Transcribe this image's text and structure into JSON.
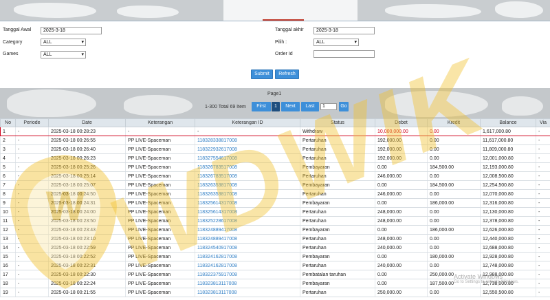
{
  "form": {
    "tanggal_awal_label": "Tanggal Awal",
    "tanggal_awal_value": "2025-3-18",
    "tanggal_akhir_label": "Tanggal akhir",
    "tanggal_akhir_value": "2025-3-18",
    "category_label": "Category",
    "category_value": "ALL",
    "pilih_label": "Pilih :",
    "pilih_value": "ALL",
    "games_label": "Games",
    "games_value": "ALL",
    "order_id_label": "Order Id",
    "order_id_value": "",
    "submit_label": "Submit",
    "refresh_label": "Refresh"
  },
  "pager": {
    "title": "Page1",
    "total": "1-300 Total 69 Item",
    "first": "First",
    "current": "1",
    "next": "Next",
    "last": "Last",
    "page_input": "1",
    "go": "Go"
  },
  "table": {
    "headers": [
      "No",
      "Periode",
      "Date",
      "Keterangan",
      "Keterangan ID",
      "Status",
      "Debet",
      "Kredit",
      "Balance",
      "Via"
    ],
    "rows": [
      [
        "1",
        "-",
        "2025-03-18 00:28:23",
        "-",
        "-",
        "Withdraw",
        "10,000,000.00",
        "0.00",
        "1,617,000.80",
        "-"
      ],
      [
        "2",
        "-",
        "2025-03-18 00:26:55",
        "PP LIVE-Spaceman",
        "118328338817008",
        "Pertaruhan",
        "192,000.00",
        "0.00",
        "11,617,000.80",
        "-"
      ],
      [
        "3",
        "-",
        "2025-03-18 00:26:40",
        "PP LIVE-Spaceman",
        "118322932617008",
        "Pertaruhan",
        "192,000.00",
        "0.00",
        "11,809,000.80",
        "-"
      ],
      [
        "4",
        "-",
        "2025-03-18 00:26:23",
        "PP LIVE-Spaceman",
        "118327554617008",
        "Pertaruhan",
        "192,000.00",
        "0.00",
        "12,001,000.80",
        "-"
      ],
      [
        "5",
        "-",
        "2025-03-18 00:25:26",
        "PP LIVE-Spaceman",
        "118326783517008",
        "Pembayaran",
        "0.00",
        "184,500.00",
        "12,193,000.80",
        "-"
      ],
      [
        "6",
        "-",
        "2025-03-18 00:25:14",
        "PP LIVE-Spaceman",
        "118326783517008",
        "Pertaruhan",
        "246,000.00",
        "0.00",
        "12,008,500.80",
        "-"
      ],
      [
        "7",
        "-",
        "2025-03-18 00:25:07",
        "PP LIVE-Spaceman",
        "118326353817008",
        "Pembayaran",
        "0.00",
        "184,500.00",
        "12,254,500.80",
        "-"
      ],
      [
        "8",
        "-",
        "2025-03-18 00:24:50",
        "PP LIVE-Spaceman",
        "118326353817008",
        "Pertaruhan",
        "246,000.00",
        "0.00",
        "12,070,000.80",
        "-"
      ],
      [
        "9",
        "-",
        "2025-03-18 00:24:31",
        "PP LIVE-Spaceman",
        "118325614317008",
        "Pembayaran",
        "0.00",
        "186,000.00",
        "12,316,000.80",
        "-"
      ],
      [
        "10",
        "-",
        "2025-03-18 00:24:00",
        "PP LIVE-Spaceman",
        "118325614317008",
        "Pertaruhan",
        "248,000.00",
        "0.00",
        "12,130,000.80",
        "-"
      ],
      [
        "11",
        "-",
        "2025-03-18 00:23:50",
        "PP LIVE-Spaceman",
        "118325228617008",
        "Pertaruhan",
        "248,000.00",
        "0.00",
        "12,378,000.80",
        "-"
      ],
      [
        "12",
        "-",
        "2025-03-18 00:23:43",
        "PP LIVE-Spaceman",
        "118324889417008",
        "Pembayaran",
        "0.00",
        "186,000.00",
        "12,626,000.80",
        "-"
      ],
      [
        "13",
        "-",
        "2025-03-18 00:23:10",
        "PP LIVE-Spaceman",
        "118324889417008",
        "Pertaruhan",
        "248,000.00",
        "0.00",
        "12,440,000.80",
        "-"
      ],
      [
        "14",
        "-",
        "2025-03-18 00:22:59",
        "PP LIVE-Spaceman",
        "118324540917008",
        "Pertaruhan",
        "240,000.00",
        "0.00",
        "12,688,000.80",
        "-"
      ],
      [
        "15",
        "-",
        "2025-03-18 00:22:52",
        "PP LIVE-Spaceman",
        "118324162817008",
        "Pembayaran",
        "0.00",
        "180,000.00",
        "12,928,000.80",
        "-"
      ],
      [
        "16",
        "-",
        "2025-03-18 00:22:31",
        "PP LIVE-Spaceman",
        "118324162817008",
        "Pertaruhan",
        "240,000.00",
        "0.00",
        "12,748,000.80",
        "-"
      ],
      [
        "17",
        "-",
        "2025-03-18 00:22:30",
        "PP LIVE-Spaceman",
        "118322375917008",
        "Pembatalan taruhan",
        "0.00",
        "250,000.00",
        "12,988,000.80",
        "-"
      ],
      [
        "18",
        "-",
        "2025-03-18 00:22:24",
        "PP LIVE-Spaceman",
        "118323813117008",
        "Pembayaran",
        "0.00",
        "187,500.00",
        "12,738,000.80",
        "-"
      ],
      [
        "19",
        "-",
        "2025-03-18 00:21:55",
        "PP LIVE-Spaceman",
        "118323813117008",
        "Pertaruhan",
        "250,000.00",
        "0.00",
        "12,550,500.80",
        "-"
      ]
    ]
  },
  "watermark": {
    "brand": "WDWIK",
    "activate_title": "Activate Windows",
    "activate_sub": "Go to Settings to activate Windows."
  },
  "colors": {
    "accent": "#3d8fd9",
    "highlight": "#d0021b",
    "link": "#2a7bc4",
    "watermark": "#f2c230"
  }
}
